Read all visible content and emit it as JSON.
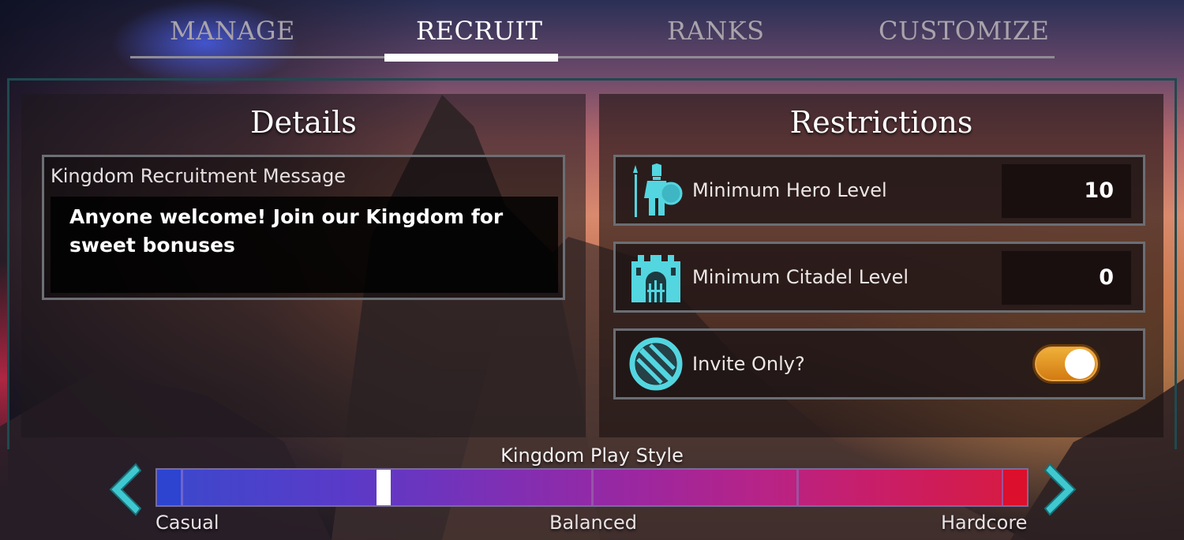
{
  "tabs": [
    {
      "label": "MANAGE",
      "active": false
    },
    {
      "label": "RECRUIT",
      "active": true
    },
    {
      "label": "RANKS",
      "active": false
    },
    {
      "label": "CUSTOMIZE",
      "active": false
    }
  ],
  "details": {
    "title": "Details",
    "message_label": "Kingdom Recruitment Message",
    "message": "Anyone welcome! Join our Kingdom for sweet bonuses"
  },
  "restrictions": {
    "title": "Restrictions",
    "min_hero": {
      "label": "Minimum Hero Level",
      "value": "10",
      "icon": "hero-icon"
    },
    "min_citadel": {
      "label": "Minimum Citadel Level",
      "value": "0",
      "icon": "citadel-icon"
    },
    "invite_only": {
      "label": "Invite Only?",
      "value": true,
      "icon": "no-entry-icon"
    }
  },
  "play_style": {
    "title": "Kingdom Play Style",
    "labels": {
      "left": "Casual",
      "middle": "Balanced",
      "right": "Hardcore"
    },
    "selected_fraction": 0.26,
    "colors": {
      "casual": "#2c44d0",
      "balanced": "#9b27a0",
      "hardcore": "#dc0f2c"
    }
  },
  "colors": {
    "accent": "#f0b23a",
    "icon_teal": "#53d6e0"
  }
}
